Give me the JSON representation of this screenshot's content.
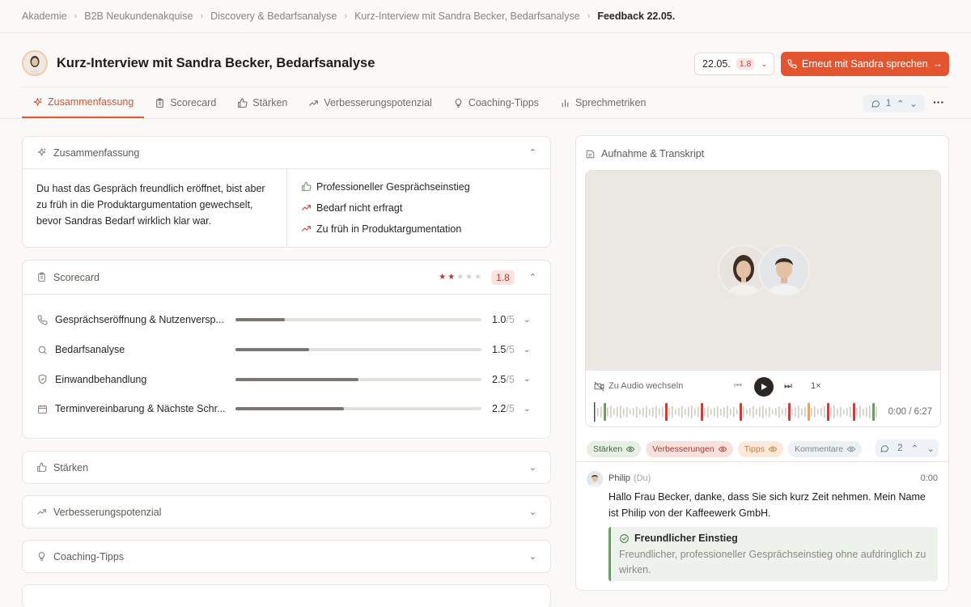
{
  "breadcrumb": [
    "Akademie",
    "B2B Neukundenakquise",
    "Discovery & Bedarfsanalyse",
    "Kurz-Interview mit Sandra Becker, Bedarfsanalyse",
    "Feedback 22.05."
  ],
  "header": {
    "title": "Kurz-Interview mit Sandra Becker, Bedarfsanalyse",
    "date": "22.05.",
    "date_score": "1.8",
    "cta_label": "Erneut mit Sandra sprechen",
    "cta_arrow": "→"
  },
  "tabs": [
    {
      "label": "Zusammenfassung",
      "icon": "sparkle-icon",
      "active": true
    },
    {
      "label": "Scorecard",
      "icon": "clipboard-icon",
      "active": false
    },
    {
      "label": "Stärken",
      "icon": "thumbs-up-icon",
      "active": false
    },
    {
      "label": "Verbesserungspotenzial",
      "icon": "trending-icon",
      "active": false
    },
    {
      "label": "Coaching-Tipps",
      "icon": "lightbulb-icon",
      "active": false
    },
    {
      "label": "Sprechmetriken",
      "icon": "bar-chart-icon",
      "active": false
    }
  ],
  "comment_nav": {
    "count": "1"
  },
  "summary": {
    "title": "Zusammenfassung",
    "text": "Du hast das Gespräch freundlich eröffnet, bist aber zu früh in die Produktargumentation gewechselt, bevor Sandras Bedarf wirklich klar war.",
    "points": [
      {
        "label": "Professioneller Gesprächseinstieg",
        "type": "positive"
      },
      {
        "label": "Bedarf nicht erfragt",
        "type": "negative"
      },
      {
        "label": "Zu früh in Produktargumentation",
        "type": "negative"
      }
    ]
  },
  "scorecard": {
    "title": "Scorecard",
    "stars_filled": 2,
    "stars_total": 5,
    "score": "1.8",
    "max_suffix": "/5",
    "rows": [
      {
        "label": "Gesprächseröffnung & Nutzenversp...",
        "value": 1.0,
        "value_text": "1.0",
        "icon": "phone-icon"
      },
      {
        "label": "Bedarfsanalyse",
        "value": 1.5,
        "value_text": "1.5",
        "icon": "search-icon"
      },
      {
        "label": "Einwandbehandlung",
        "value": 2.5,
        "value_text": "2.5",
        "icon": "shield-icon"
      },
      {
        "label": "Terminvereinbarung & Nächste Schr...",
        "value": 2.2,
        "value_text": "2.2",
        "icon": "calendar-icon"
      }
    ]
  },
  "sections": {
    "strengths": "Stärken",
    "improvements": "Verbesserungspotenzial",
    "coaching": "Coaching-Tipps"
  },
  "recording": {
    "title": "Aufnahme & Transkript",
    "audio_switch": "Zu Audio wechseln",
    "speed": "1×",
    "timecode": "0:00 / 6:27",
    "filters": [
      "Stärken",
      "Verbesserungen",
      "Tipps",
      "Kommentare"
    ],
    "comment_count": "2"
  },
  "transcript": {
    "speaker": "Philip",
    "speaker_tag": "(Du)",
    "time": "0:00",
    "text": "Hallo Frau Becker, danke, dass Sie sich kurz Zeit nehmen. Mein Name ist Philip von der Kaffeewerk GmbH.",
    "annotation_title": "Freundlicher Einstieg",
    "annotation_text": "Freundlicher, professioneller Gesprächseinstieg ohne aufdringlich zu wirken."
  },
  "colors": {
    "accent": "#e3552f",
    "positive": "#6d9a67",
    "negative": "#c2413a"
  }
}
